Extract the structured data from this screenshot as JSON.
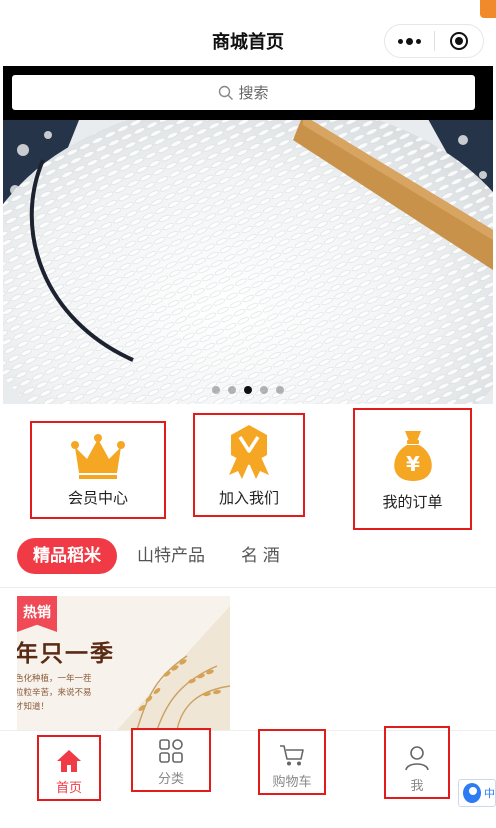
{
  "navbar": {
    "title": "商城首页"
  },
  "search": {
    "placeholder": "搜索"
  },
  "banner": {
    "slide_count": 5,
    "active_slide": 3
  },
  "entries": [
    {
      "label": "会员中心",
      "icon": "crown-icon",
      "color": "#f5a623"
    },
    {
      "label": "加入我们",
      "icon": "badge-ribbon-icon",
      "color": "#f5a623"
    },
    {
      "label": "我的订单",
      "icon": "money-bag-icon",
      "color": "#f5a623"
    }
  ],
  "tabs": [
    {
      "label": "精品稻米",
      "active": true
    },
    {
      "label": "山特产品",
      "active": false
    },
    {
      "label": "名 酒",
      "active": false
    }
  ],
  "product": {
    "badge": "热销",
    "headline": "年只一季",
    "lines": [
      "色化种植，一年一茬",
      "粒粒辛苦，来说不易",
      "才知道！"
    ]
  },
  "tabbar": [
    {
      "label": "首页",
      "icon": "home-icon",
      "active": true
    },
    {
      "label": "分类",
      "icon": "category-icon",
      "active": false
    },
    {
      "label": "购物车",
      "icon": "cart-icon",
      "active": false
    },
    {
      "label": "我",
      "icon": "user-icon",
      "active": false
    }
  ],
  "service": {
    "label": "中"
  },
  "colors": {
    "accent": "#f03b46",
    "highlight_border": "#e21b1b",
    "icon_gold": "#f5a623"
  }
}
